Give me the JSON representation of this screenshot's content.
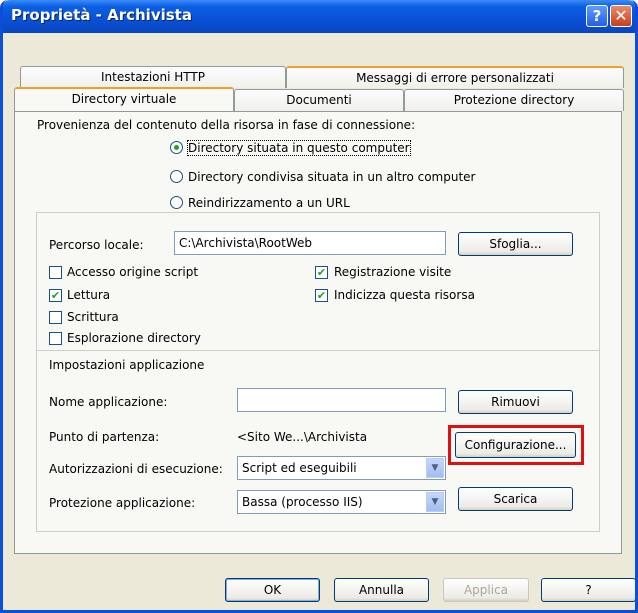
{
  "window": {
    "title": "Proprietà - Archivista",
    "help_button": "?",
    "close_button": "✕"
  },
  "tabs": {
    "row1": [
      "Intestazioni HTTP",
      "Messaggi di errore personalizzati"
    ],
    "row2": [
      "Directory virtuale",
      "Documenti",
      "Protezione directory"
    ],
    "active": "Directory virtuale"
  },
  "source": {
    "label": "Provenienza del contenuto della risorsa in fase di connessione:",
    "options": [
      {
        "label": "Directory situata in questo computer",
        "selected": true
      },
      {
        "label": "Directory condivisa situata in un altro computer",
        "selected": false
      },
      {
        "label": "Reindirizzamento a un URL",
        "selected": false
      }
    ]
  },
  "local_path": {
    "label": "Percorso locale:",
    "value": "C:\\Archivista\\RootWeb",
    "browse_button": "Sfoglia..."
  },
  "checkboxes": {
    "left": [
      {
        "label": "Accesso origine script",
        "checked": false
      },
      {
        "label": "Lettura",
        "checked": true
      },
      {
        "label": "Scrittura",
        "checked": false
      },
      {
        "label": "Esplorazione directory",
        "checked": false
      }
    ],
    "right": [
      {
        "label": "Registrazione visite",
        "checked": true
      },
      {
        "label": "Indicizza questa risorsa",
        "checked": true
      }
    ]
  },
  "app_settings": {
    "header": "Impostazioni applicazione",
    "name_label": "Nome applicazione:",
    "name_value": "",
    "remove_button": "Rimuovi",
    "start_label": "Punto di partenza:",
    "start_value": "<Sito We...\\Archivista",
    "config_button": "Configurazione...",
    "exec_label": "Autorizzazioni di esecuzione:",
    "exec_value": "Script ed eseguibili",
    "protection_label": "Protezione applicazione:",
    "protection_value": "Bassa (processo IIS)",
    "unload_button": "Scarica"
  },
  "footer": {
    "ok": "OK",
    "cancel": "Annulla",
    "apply": "Applica",
    "help": "?"
  },
  "colors": {
    "highlight_box": "#e01010",
    "titlebar": "#0a51d6",
    "check": "#21a121"
  }
}
